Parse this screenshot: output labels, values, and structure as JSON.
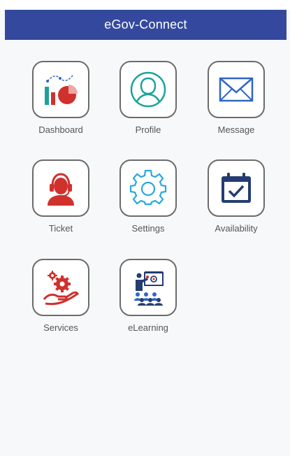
{
  "app": {
    "title": "eGov-Connect"
  },
  "tiles": [
    {
      "label": "Dashboard",
      "icon": "dashboard-chart-icon"
    },
    {
      "label": "Profile",
      "icon": "profile-user-icon"
    },
    {
      "label": "Message",
      "icon": "envelope-icon"
    },
    {
      "label": "Ticket",
      "icon": "support-agent-icon"
    },
    {
      "label": "Settings",
      "icon": "gear-icon"
    },
    {
      "label": "Availability",
      "icon": "calendar-check-icon"
    },
    {
      "label": "Services",
      "icon": "services-hand-gear-icon"
    },
    {
      "label": "eLearning",
      "icon": "presentation-classroom-icon"
    }
  ],
  "colors": {
    "header": "#34499e",
    "tile_border": "#6b6b6b",
    "red": "#d0312d",
    "teal": "#1aa39a",
    "blue": "#2f66c6",
    "navy": "#243c73",
    "sky": "#28a8e0"
  }
}
